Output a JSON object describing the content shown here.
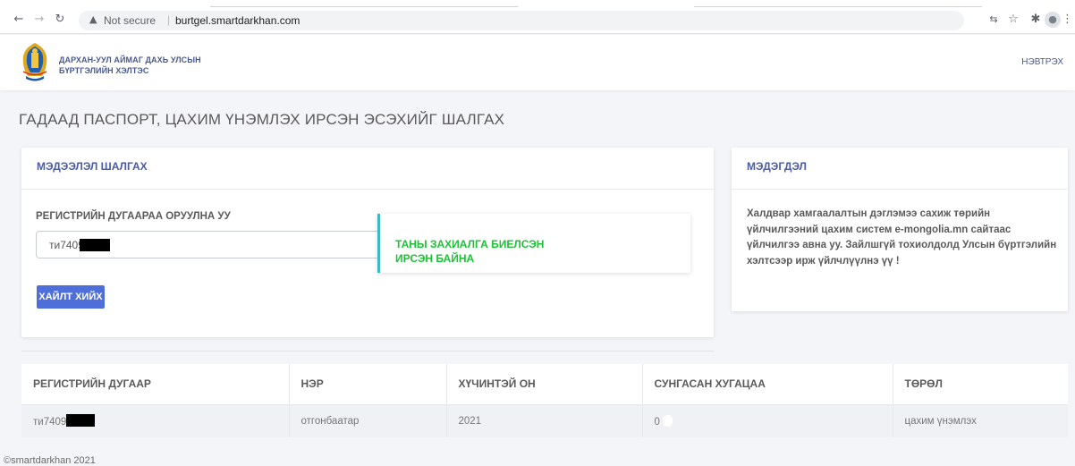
{
  "browser": {
    "back_icon": "back-arrow-icon",
    "forward_icon": "forward-arrow-icon",
    "reload_icon": "reload-icon",
    "security_label": "Not secure",
    "url": "burtgel.smartdarkhan.com",
    "right_icons": [
      "translate-icon",
      "star-icon",
      "extensions-icon",
      "profile-icon",
      "menu-icon"
    ]
  },
  "header": {
    "org_line1": "ДАРХАН-УУЛ АЙМАГ ДАХЬ УЛСЫН",
    "org_line2": "БҮРТГЭЛИЙН ХЭЛТЭС",
    "login": "НЭВТРЭХ"
  },
  "page": {
    "title": "ГАДААД ПАСПОРТ, ЦАХИМ ҮНЭМЛЭХ ИРСЭН ЭСЭХИЙГ ШАЛГАХ"
  },
  "search": {
    "card_title": "МЭДЭЭЛЭЛ ШАЛГАХ",
    "field_label": "РЕГИСТРИЙН ДУГААРАА ОРУУЛНА УУ",
    "input_value": "ти7409",
    "button_label": "ХАЙЛТ ХИЙХ",
    "result_message": "ТАНЫ ЗАХИАЛГА БИЕЛСЭН ИРСЭН БАЙНА"
  },
  "notice": {
    "card_title": "МЭДЭГДЭЛ",
    "body": "Халдвар хамгаалалтын дэглэмээ сахиж төрийн үйлчилгээний цахим систем e-mongolia.mn сайтаас үйлчилгээ авна уу. Зайлшгүй тохиолдолд Улсын бүртгэлийн хэлтсээр ирж үйлчлүүлнэ үү !"
  },
  "table": {
    "columns": [
      "РЕГИСТРИЙН ДУГААР",
      "НЭР",
      "ХҮЧИНТЭЙ ОН",
      "СУНГАСАН ХУГАЦАА",
      "ТӨРӨЛ"
    ],
    "rows": [
      {
        "register": "ти7409",
        "name": "отгонбаатар",
        "year": "2021",
        "extended": "0",
        "type": "цахим үнэмлэх"
      }
    ]
  },
  "footer": {
    "text": "©smartdarkhan 2021"
  },
  "colors": {
    "accent": "#4e6fd9",
    "heading_blue": "#485ba5",
    "success": "#1ec036",
    "result_border": "#3bb8c3"
  }
}
